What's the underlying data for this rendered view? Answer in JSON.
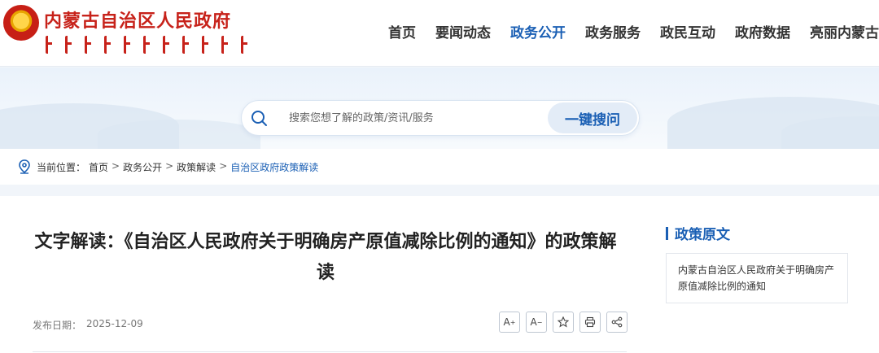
{
  "header": {
    "site_title": "内蒙古自治区人民政府",
    "nav": [
      {
        "label": "首页",
        "active": false
      },
      {
        "label": "要闻动态",
        "active": false
      },
      {
        "label": "政务公开",
        "active": true
      },
      {
        "label": "政务服务",
        "active": false
      },
      {
        "label": "政民互动",
        "active": false
      },
      {
        "label": "政府数据",
        "active": false
      },
      {
        "label": "亮丽内蒙古",
        "active": false
      }
    ]
  },
  "search": {
    "placeholder": "搜索您想了解的政策/资讯/服务",
    "button_label": "一键搜问"
  },
  "breadcrumb": {
    "prefix": "当前位置：",
    "items": [
      "首页",
      "政务公开",
      "政策解读",
      "自治区政府政策解读"
    ],
    "separator": ">"
  },
  "article": {
    "title": "文字解读：《自治区人民政府关于明确房产原值减除比例的通知》的政策解读",
    "date_label": "发布日期：",
    "date": "2025-12-09",
    "tools": {
      "font_increase": "A",
      "font_decrease": "A",
      "font_increase_sup": "+",
      "font_decrease_sup": "−"
    }
  },
  "sidebar": {
    "heading": "政策原文",
    "item": "内蒙古自治区人民政府关于明确房产原值减除比例的通知"
  },
  "colors": {
    "brand_red": "#c7221a",
    "accent_blue": "#1a5fb4"
  }
}
